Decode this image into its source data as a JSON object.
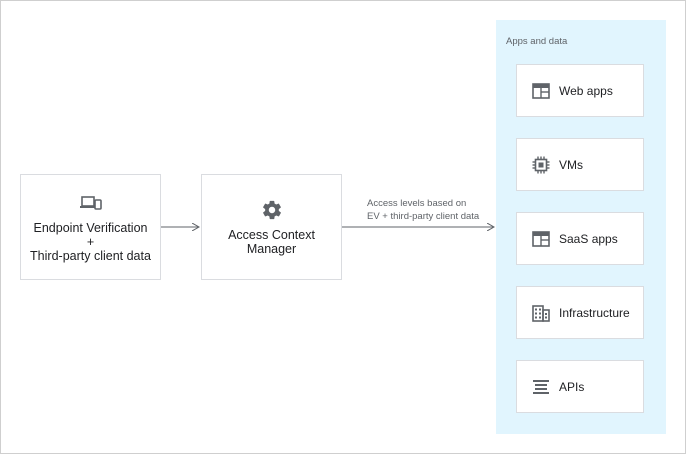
{
  "source_node": {
    "icon": "devices-icon",
    "line1": "Endpoint Verification",
    "line2": "+",
    "line3": "Third-party client data"
  },
  "middle_node": {
    "icon": "gear-icon",
    "line1": "Access Context",
    "line2": "Manager"
  },
  "edge_label": {
    "line1": "Access levels based on",
    "line2": "EV + third-party client data"
  },
  "apps_panel": {
    "title": "Apps and data",
    "items": [
      {
        "label": "Web apps",
        "icon": "browser-window-icon"
      },
      {
        "label": "VMs",
        "icon": "chip-icon"
      },
      {
        "label": "SaaS apps",
        "icon": "browser-window-icon"
      },
      {
        "label": "Infrastructure",
        "icon": "building-icon"
      },
      {
        "label": "APIs",
        "icon": "lines-icon"
      }
    ]
  },
  "colors": {
    "panel_bg": "#e1f5fe",
    "border": "#dadce0",
    "icon": "#5f6368",
    "arrow": "#5f6368"
  }
}
